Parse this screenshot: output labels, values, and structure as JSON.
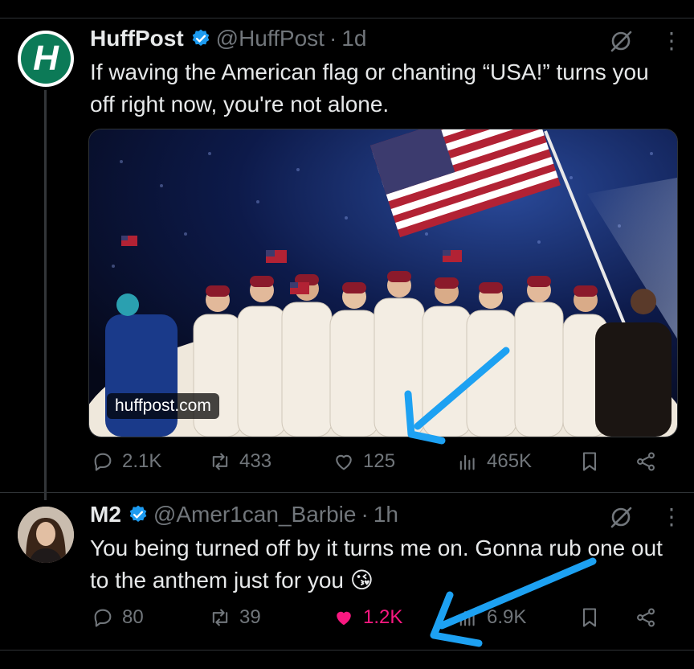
{
  "tweets": [
    {
      "name": "HuffPost",
      "handle": "@HuffPost",
      "time": "1d",
      "avatar_letter": "H",
      "text": "If waving the American flag or chanting “USA!” turns you off right now, you're not alone.",
      "media_domain": "huffpost.com",
      "replies": "2.1K",
      "reposts": "433",
      "likes": "125",
      "views": "465K"
    },
    {
      "name": "M2",
      "handle": "@Amer1can_Barbie",
      "time": "1h",
      "text": "You being turned off by it turns me on. Gonna rub one out to the anthem just for you 😘",
      "replies": "80",
      "reposts": "39",
      "likes": "1.2K",
      "views": "6.9K"
    }
  ],
  "icons": {
    "verified": "verified-badge-icon",
    "grok": "grok-icon",
    "more": "more-icon",
    "reply": "reply-icon",
    "repost": "repost-icon",
    "like": "heart-icon",
    "views": "views-icon",
    "bookmark": "bookmark-icon",
    "share": "share-icon"
  },
  "colors": {
    "background": "#000000",
    "text": "#e7e9ea",
    "muted": "#71767b",
    "verified": "#1d9bf0",
    "like_active": "#f91880",
    "annotation_arrow": "#1da1f2",
    "huffpost_green": "#0c7a57"
  }
}
